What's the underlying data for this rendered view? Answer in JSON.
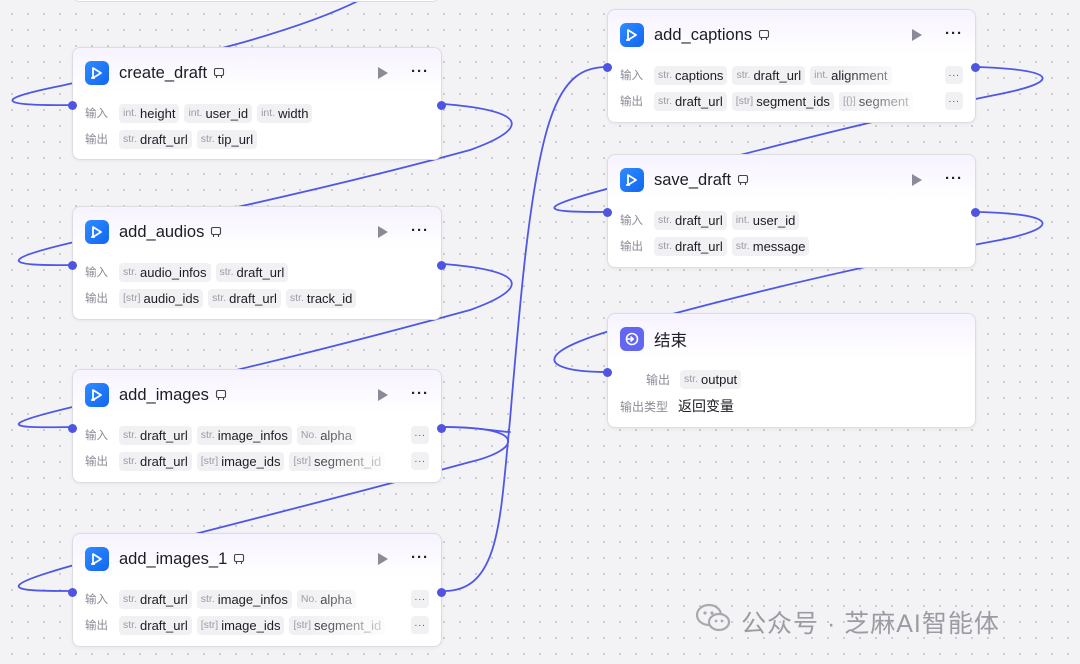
{
  "labels": {
    "input": "输入",
    "output": "输出",
    "output_type": "输出类型",
    "more": "···"
  },
  "nodes": [
    {
      "id": "create_draft",
      "title": "create_draft",
      "inputs": [
        {
          "type": "int.",
          "name": "height"
        },
        {
          "type": "int.",
          "name": "user_id"
        },
        {
          "type": "int.",
          "name": "width"
        }
      ],
      "outputs": [
        {
          "type": "str.",
          "name": "draft_url"
        },
        {
          "type": "str.",
          "name": "tip_url"
        }
      ]
    },
    {
      "id": "add_audios",
      "title": "add_audios",
      "inputs": [
        {
          "type": "str.",
          "name": "audio_infos"
        },
        {
          "type": "str.",
          "name": "draft_url"
        }
      ],
      "outputs": [
        {
          "type": "[str]",
          "name": "audio_ids"
        },
        {
          "type": "str.",
          "name": "draft_url"
        },
        {
          "type": "str.",
          "name": "track_id"
        }
      ]
    },
    {
      "id": "add_images",
      "title": "add_images",
      "inputs": [
        {
          "type": "str.",
          "name": "draft_url"
        },
        {
          "type": "str.",
          "name": "image_infos"
        },
        {
          "type": "No.",
          "name": "alpha"
        }
      ],
      "outputs": [
        {
          "type": "str.",
          "name": "draft_url"
        },
        {
          "type": "[str]",
          "name": "image_ids"
        },
        {
          "type": "[str]",
          "name": "segment_id"
        }
      ]
    },
    {
      "id": "add_images_1",
      "title": "add_images_1",
      "inputs": [
        {
          "type": "str.",
          "name": "draft_url"
        },
        {
          "type": "str.",
          "name": "image_infos"
        },
        {
          "type": "No.",
          "name": "alpha"
        }
      ],
      "outputs": [
        {
          "type": "str.",
          "name": "draft_url"
        },
        {
          "type": "[str]",
          "name": "image_ids"
        },
        {
          "type": "[str]",
          "name": "segment_id"
        }
      ]
    },
    {
      "id": "add_captions",
      "title": "add_captions",
      "inputs": [
        {
          "type": "str.",
          "name": "captions"
        },
        {
          "type": "str.",
          "name": "draft_url"
        },
        {
          "type": "int.",
          "name": "alignment"
        }
      ],
      "outputs": [
        {
          "type": "str.",
          "name": "draft_url"
        },
        {
          "type": "[str]",
          "name": "segment_ids"
        },
        {
          "type": "[{}]",
          "name": "segment"
        }
      ]
    },
    {
      "id": "save_draft",
      "title": "save_draft",
      "inputs": [
        {
          "type": "str.",
          "name": "draft_url"
        },
        {
          "type": "int.",
          "name": "user_id"
        }
      ],
      "outputs": [
        {
          "type": "str.",
          "name": "draft_url"
        },
        {
          "type": "str.",
          "name": "message"
        }
      ]
    }
  ],
  "end_node": {
    "title": "结束",
    "output": {
      "type": "str.",
      "name": "output"
    },
    "output_type_value": "返回变量"
  },
  "watermark": {
    "text": "公众号 · 芝麻AI智能体",
    "icon": "wechat-icon"
  },
  "colors": {
    "wire": "#5057e8",
    "plugin_icon": "#1a73f5",
    "end_icon": "#6366f1"
  }
}
